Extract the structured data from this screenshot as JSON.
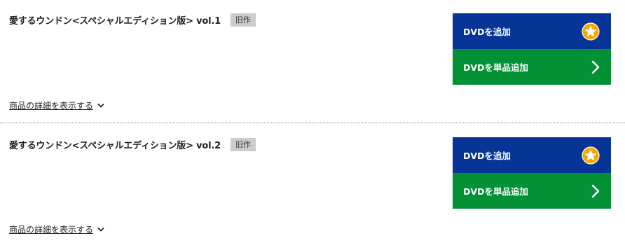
{
  "items": [
    {
      "title": "愛するウンドン<スペシャルエディション版> vol.1",
      "badge": "旧作",
      "add_dvd_label": "DVDを追加",
      "add_single_label": "DVDを単品追加",
      "details_link": "商品の詳細を表示する"
    },
    {
      "title": "愛するウンドン<スペシャルエディション版> vol.2",
      "badge": "旧作",
      "add_dvd_label": "DVDを追加",
      "add_single_label": "DVDを単品追加",
      "details_link": "商品の詳細を表示する"
    }
  ],
  "icons": {
    "add_dvd": "star-icon",
    "add_single": "chevron-right-icon",
    "details": "chevron-down-icon"
  },
  "colors": {
    "add_dvd_button": "#063597",
    "add_single_button": "#029135",
    "star_fill": "#f5a800",
    "badge_bg": "#cccccc"
  }
}
